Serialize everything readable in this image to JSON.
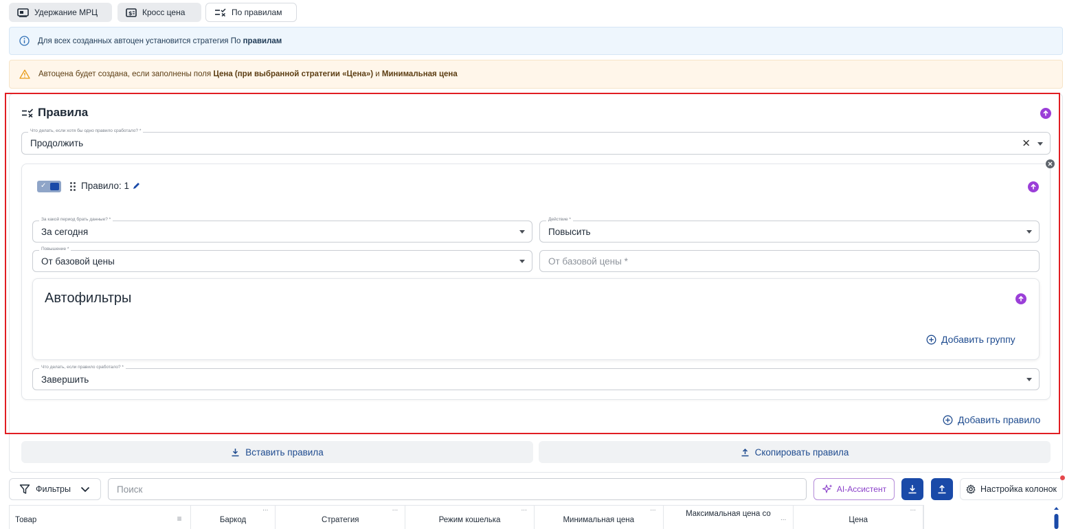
{
  "strategy_tabs": [
    {
      "label": "Удержание МРЦ",
      "icon": "rrp-hold-icon"
    },
    {
      "label": "Кросс цена",
      "icon": "cross-price-icon"
    },
    {
      "label": "По правилам",
      "icon": "rules-icon",
      "active": true
    }
  ],
  "info_alert": {
    "text": "Для всех созданных автоцен установится стратегия По ",
    "strong": "правилам"
  },
  "warn_alert": {
    "text_a": "Автоцена будет создана, если заполнены поля ",
    "strong_a": "Цена (при выбранной стратегии «Цена»)",
    "text_b": " и ",
    "strong_b": "Минимальная цена"
  },
  "rules": {
    "title": "Правила",
    "any_rule_label": "Что делать, если хотя бы одно правило сработало? *",
    "any_rule_value": "Продолжить",
    "rule": {
      "name": "Правило: 1",
      "enabled": true,
      "period_label": "За какой период брать данные? *",
      "period_value": "За сегодня",
      "action_label": "Действие *",
      "action_value": "Повысить",
      "raise_label": "Повышение *",
      "raise_value": "От базовой цены",
      "base_price_placeholder": "От базовой цены *",
      "autofilters_title": "Автофильтры",
      "add_group": "Добавить группу",
      "on_trigger_label": "Что делать, если правило сработало? *",
      "on_trigger_value": "Завершить"
    },
    "add_rule": "Добавить правило"
  },
  "actions": {
    "paste_rules": "Вставить правила",
    "copy_rules": "Скопировать правила"
  },
  "toolbar": {
    "filters": "Фильтры",
    "search_placeholder": "Поиск",
    "ai": "AI-Ассистент",
    "columns": "Настройка колонок"
  },
  "table": {
    "columns": [
      "Товар",
      "Баркод",
      "Стратегия",
      "Режим кошелька",
      "Минимальная цена",
      "Максимальная цена со",
      "Цена"
    ]
  },
  "colors": {
    "accent": "#1a4aa8",
    "purple": "#9b3fd8",
    "highlight": "#e11d22"
  }
}
